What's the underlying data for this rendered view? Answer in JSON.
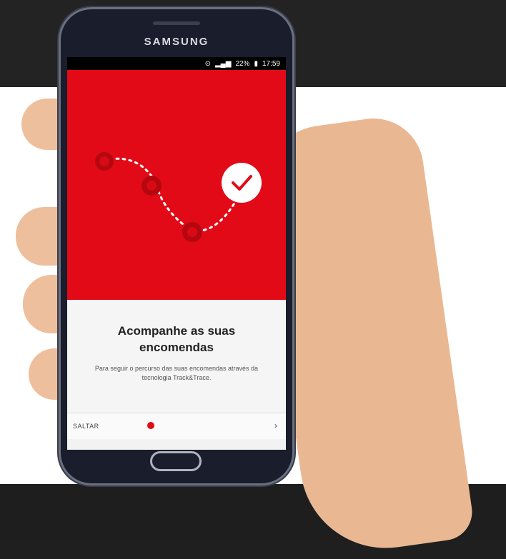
{
  "device": {
    "brand": "SAMSUNG"
  },
  "status_bar": {
    "battery": "22%",
    "time": "17:59"
  },
  "onboarding": {
    "title": "Acompanhe as suas encomendas",
    "description": "Para seguir o percurso das suas encomendas através da tecnologia Track&Trace.",
    "skip_label": "SALTAR",
    "next_label": "›",
    "page_index": 1
  },
  "colors": {
    "accent": "#e20a17",
    "background_band": "#232323"
  },
  "icons": [
    "wifi-icon",
    "signal-icon",
    "battery-icon",
    "checkmark-icon",
    "route-stop-icon"
  ]
}
